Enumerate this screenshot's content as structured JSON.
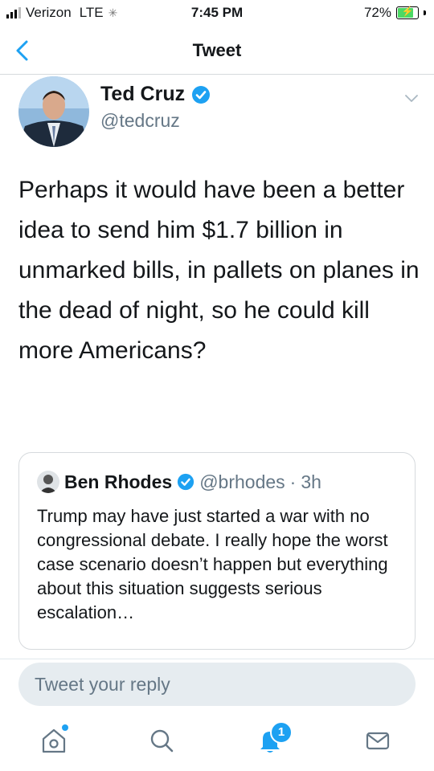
{
  "status_bar": {
    "carrier": "Verizon",
    "network": "LTE",
    "time": "7:45 PM",
    "battery": "72%",
    "battery_level": 0.72
  },
  "header": {
    "title": "Tweet"
  },
  "tweet": {
    "author_name": "Ted Cruz",
    "author_handle": "@tedcruz",
    "text": "Perhaps it would have been a better idea to send him $1.7 billion in unmarked bills, in pallets on planes in the dead of night, so he could kill more Americans?"
  },
  "quoted_tweet": {
    "author_name": "Ben Rhodes",
    "author_handle": "@brhodes",
    "separator": "·",
    "time": "3h",
    "text": "Trump may have just started a war with no congressional debate. I really hope the worst case scenario doesn’t happen but everything about this situation suggests serious escalation…"
  },
  "reply": {
    "placeholder": "Tweet your reply"
  },
  "tabbar": {
    "notifications_badge": "1"
  },
  "colors": {
    "accent": "#1da1f2",
    "secondary_text": "#657786",
    "divider": "#d6dadd"
  }
}
